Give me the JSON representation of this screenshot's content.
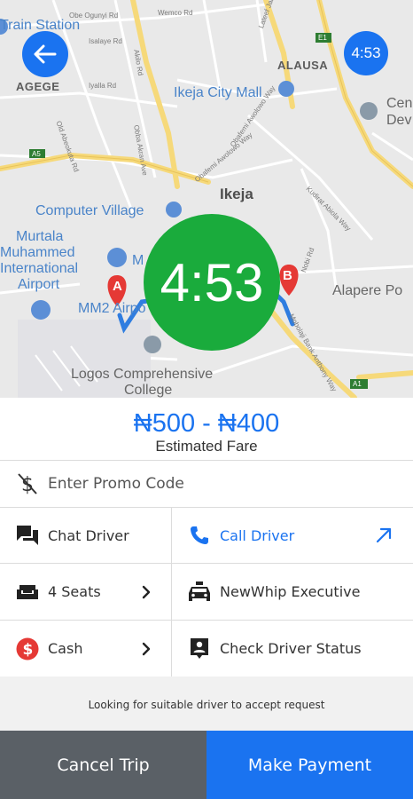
{
  "map": {
    "labels": {
      "train_station": "Train Station",
      "agege": "AGEGE",
      "alausa": "ALAUSA",
      "ikeja_city_mall": "Ikeja City Mall",
      "cen_dev_1": "Cen",
      "cen_dev_2": "Dev",
      "ikeja": "Ikeja",
      "computer_village": "Computer Village",
      "murtala_1": "Murtala",
      "murtala_2": "Muhammed",
      "murtala_3": "International",
      "murtala_4": "Airport",
      "mm_partial": "M",
      "mm2_airport": "MM2 Airpo",
      "alapere": "Alapere Po",
      "logos_1": "Logos Comprehensive",
      "logos_2": "College",
      "road_obe_ogunyi": "Obe Ogunyi Rd",
      "road_wemco": "Wemco Rd",
      "road_iyalaje": "Isalaye Rd",
      "road_iyalla": "Iyalla Rd",
      "road_abeokuta": "Old Abeokuta Rd",
      "road_akilo": "Akilo Rd",
      "road_obafemi": "Obafemi Awolowo Way",
      "road_obafemi2": "Obafemi Awolowo Way",
      "road_kudirat": "Kudirat Abiola Way",
      "road_obba": "Obba Akran Ave",
      "road_lateef": "Lateef Jakande Rd",
      "road_mobolaji": "Mobolaji Bank Anthony Way",
      "road_nobi": "Nobi Rd",
      "road_a5": "A5",
      "road_a1": "A1",
      "road_e1": "E1",
      "road_jak": "Isa"
    },
    "pins": {
      "a": "A",
      "b": "B"
    }
  },
  "header": {
    "back_icon": "arrow-left-icon",
    "timer_small": "4:53"
  },
  "timer_big": "4:53",
  "fare": {
    "amount": "₦500 - ₦400",
    "label": "Estimated Fare"
  },
  "promo": {
    "placeholder": "Enter Promo Code",
    "icon": "no-dollar-icon"
  },
  "options": {
    "chat_driver": "Chat Driver",
    "call_driver": "Call Driver",
    "seats": "4 Seats",
    "vehicle": "NewWhip Executive",
    "payment": "Cash",
    "check_status": "Check Driver Status"
  },
  "status_message": "Looking for suitable driver to accept request",
  "buttons": {
    "cancel": "Cancel Trip",
    "pay": "Make Payment"
  },
  "colors": {
    "primary": "#1a73f0",
    "timer_green": "#1aab3c",
    "cancel_gray": "#5a6066",
    "cash_red": "#e53935"
  }
}
